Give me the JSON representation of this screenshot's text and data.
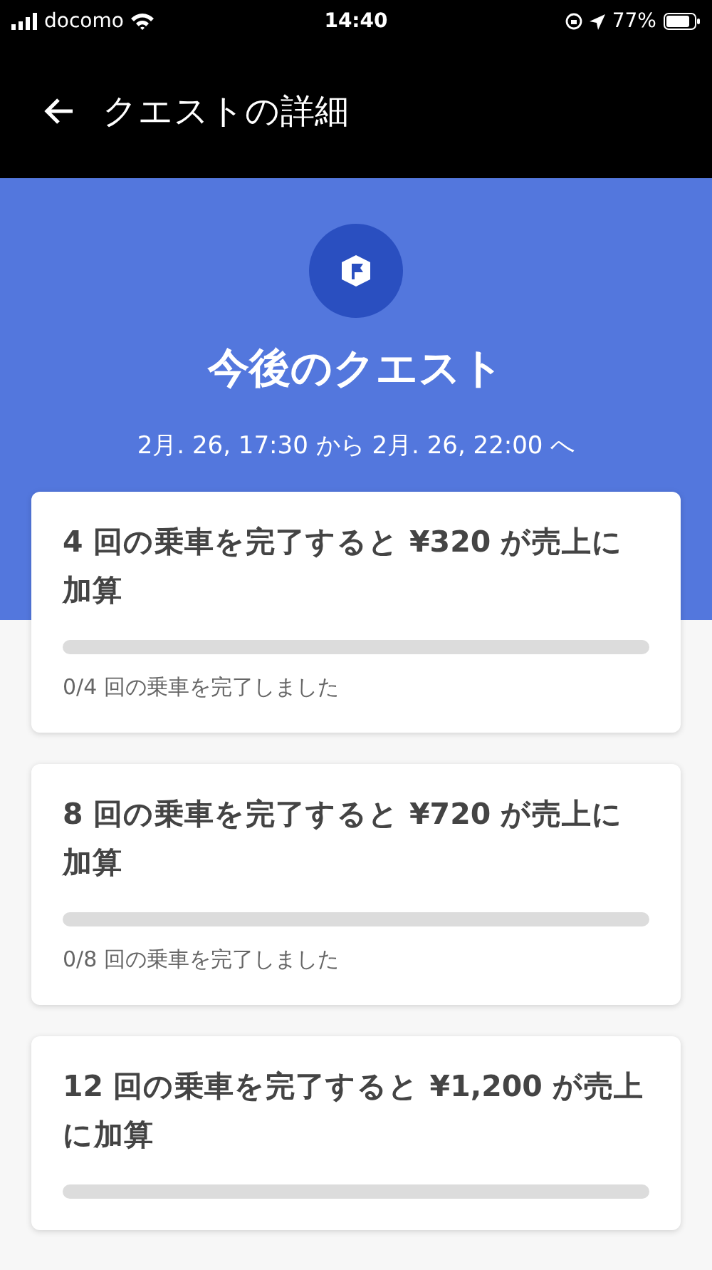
{
  "status_bar": {
    "carrier": "docomo",
    "time": "14:40",
    "battery": "77%"
  },
  "app_bar": {
    "title": "クエストの詳細"
  },
  "header": {
    "title": "今後のクエスト",
    "period": "2月. 26, 17:30 から 2月. 26, 22:00 へ"
  },
  "quests": [
    {
      "title": "4 回の乗車を完了すると ¥320 が売上に加算",
      "level": 0,
      "progress_text": "0/4 回の乗車を完了しました"
    },
    {
      "title": "8 回の乗車を完了すると ¥720 が売上に加算",
      "level": 0,
      "progress_text": "0/8 回の乗車を完了しました"
    },
    {
      "title": "12 回の乗車を完了すると ¥1,200 が売上に加算",
      "level": 0
    }
  ]
}
